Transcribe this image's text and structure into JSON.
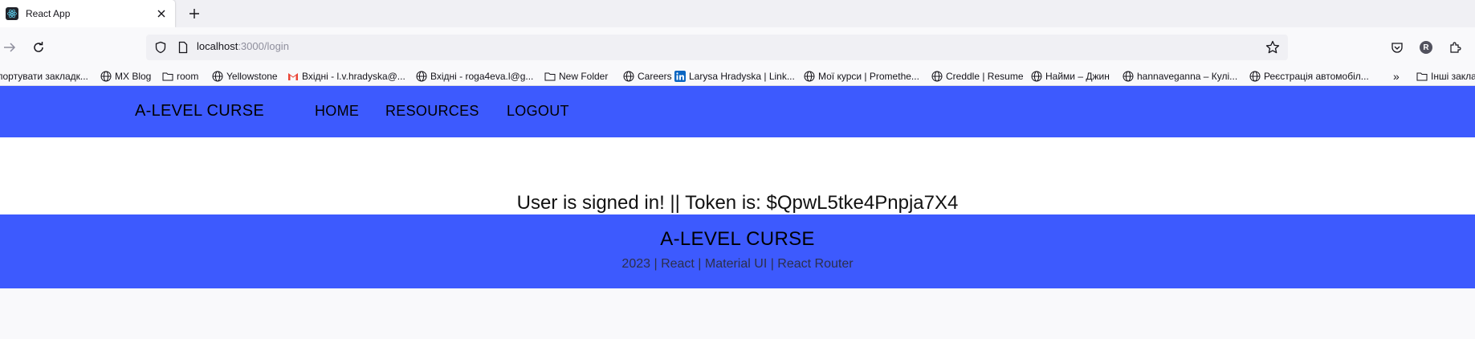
{
  "browser": {
    "tab_title": "React App",
    "url_host": "localhost",
    "url_rest": ":3000/login",
    "avatar_letter": "R"
  },
  "bookmarks": [
    {
      "label": "портувати закладк...",
      "icon": "folder-icon"
    },
    {
      "label": "MX Blog",
      "icon": "globe-icon"
    },
    {
      "label": "room",
      "icon": "folder-icon"
    },
    {
      "label": "Yellowstone",
      "icon": "globe-icon"
    },
    {
      "label": "Вхідні - l.v.hradyska@...",
      "icon": "gmail-icon"
    },
    {
      "label": "Вхідні - roga4eva.l@g...",
      "icon": "globe-icon"
    },
    {
      "label": "New Folder",
      "icon": "folder-icon"
    },
    {
      "label": "Careers",
      "icon": "globe-icon"
    },
    {
      "label": "Larysa Hradyska | Link...",
      "icon": "linkedin-icon"
    },
    {
      "label": "Мої курси | Promethe...",
      "icon": "globe-icon"
    },
    {
      "label": "Creddle | Resume",
      "icon": "globe-icon"
    },
    {
      "label": "Найми – Джин",
      "icon": "globe-icon"
    },
    {
      "label": "hannaveganna – Кулі...",
      "icon": "globe-icon"
    },
    {
      "label": "Реєстрація автомобіл...",
      "icon": "globe-icon"
    },
    {
      "label": "Інші закла",
      "icon": "folder-icon"
    }
  ],
  "app": {
    "brand": "A-LEVEL CURSE",
    "nav": [
      "HOME",
      "RESOURCES",
      "LOGOUT"
    ],
    "status": "User is signed in! || Token is: $QpwL5tke4Pnpja7X4",
    "footer_title": "A-LEVEL CURSE",
    "footer_sub": "2023 | React | Material UI | React Router"
  },
  "colors": {
    "accent": "#3d5afe"
  }
}
